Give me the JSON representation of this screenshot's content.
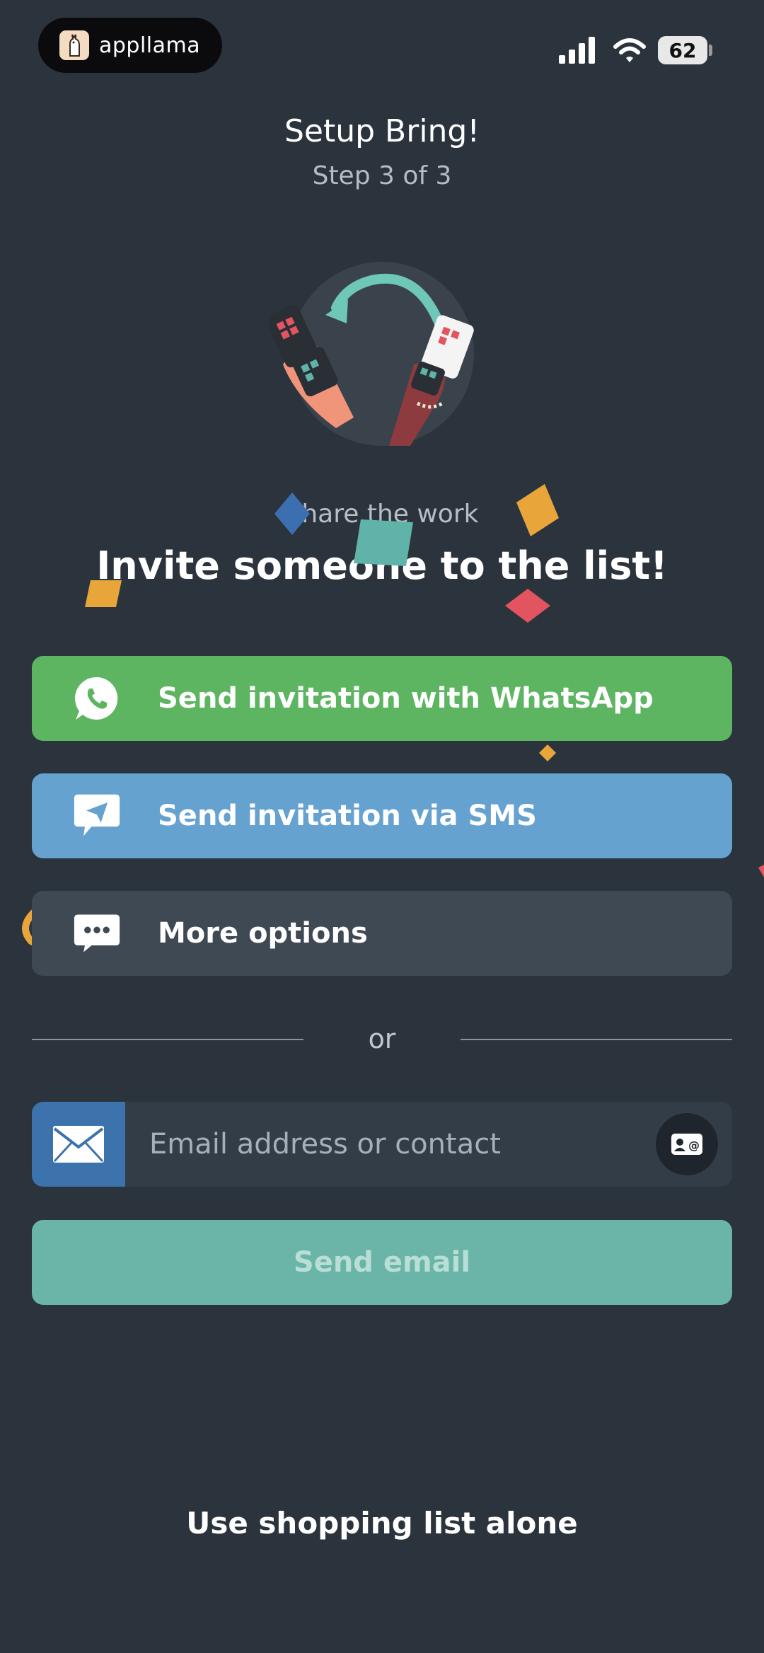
{
  "status_bar": {
    "app_badge": "appllama",
    "battery": "62"
  },
  "header": {
    "title": "Setup Bring!",
    "step": "Step 3 of 3"
  },
  "hero": {
    "tagline": "Share the work",
    "headline": "Invite someone to the list!"
  },
  "share_options": [
    {
      "label": "Send invitation with WhatsApp",
      "icon": "whatsapp-icon",
      "color": "#5db562"
    },
    {
      "label": "Send invitation via SMS",
      "icon": "send-message-icon",
      "color": "#66a2d0"
    },
    {
      "label": "More options",
      "icon": "more-chat-icon",
      "color": "#3f4953"
    }
  ],
  "separator": "or",
  "email": {
    "placeholder": "Email address or contact",
    "value": "",
    "send_label": "Send email"
  },
  "footer": {
    "alone_label": "Use shopping list alone"
  },
  "colors": {
    "background": "#2b333d",
    "whatsapp": "#5db562",
    "sms": "#66a2d0",
    "email_icon_bg": "#3d73ad",
    "send_email": "#6ab4a8",
    "confetti_yellow": "#e8a63a",
    "confetti_red": "#e2545f",
    "confetti_teal": "#5fb3a8",
    "confetti_blue": "#3c6fb0"
  }
}
